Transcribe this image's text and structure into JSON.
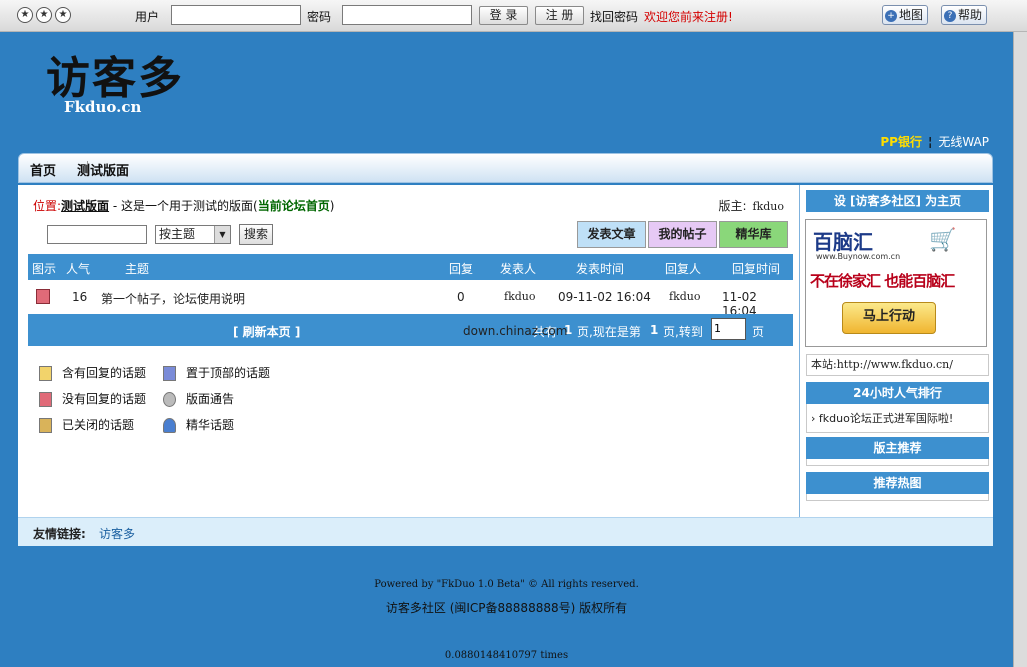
{
  "topbar": {
    "user_label": "用户",
    "pass_label": "密码",
    "login_btn": "登 录",
    "register_btn": "注 册",
    "recover": "找回密码",
    "welcome": "欢迎您前来注册!",
    "map_btn": "地图",
    "help_btn": "帮助"
  },
  "header": {
    "logo": "访客多",
    "logo_sub": "Fkduo.cn",
    "pp_bank": "PP银行",
    "sep": "¦",
    "wap": "无线WAP"
  },
  "nav": {
    "home": "首页",
    "board": "测试版面"
  },
  "location": {
    "label": "位置:",
    "board": "测试版面",
    "desc": " - 这是一个用于测试的版面(",
    "forum_home": "当前论坛首页",
    "close": ")",
    "moderator_label": "版主:",
    "moderator": "fkduo"
  },
  "search": {
    "select_value": "按主题",
    "search_btn": "搜索"
  },
  "actions": {
    "post": "发表文章",
    "my_posts": "我的帖子",
    "elite": "精华库"
  },
  "table": {
    "headers": [
      "图示",
      "人气",
      "主题",
      "回复",
      "发表人",
      "发表时间",
      "回复人",
      "回复时间"
    ],
    "row": {
      "popularity": "16",
      "title": "第一个帖子，论坛使用说明",
      "replies": "0",
      "author": "fkduo",
      "post_time": "09-11-02 16:04",
      "replier": "fkduo",
      "reply_time": "11-02 16:04"
    }
  },
  "pager": {
    "refresh": "[ 刷新本页 ]",
    "total_prefix": "共有",
    "total": "1",
    "current_text": "页,现在是第",
    "current": "1",
    "goto_text": "页,转到",
    "goto_value": "1",
    "suffix": "页"
  },
  "watermark": "down.chinaz.com",
  "legend": {
    "has_reply": "含有回复的话题",
    "top": "置于顶部的话题",
    "no_reply": "没有回复的话题",
    "notice": "版面通告",
    "closed": "已关闭的话题",
    "elite": "精华话题"
  },
  "friends": {
    "label": "友情链接:",
    "link": "访客多"
  },
  "footer": {
    "powered": "Powered by \"FkDuo 1.0 Beta\" © All rights reserved.",
    "copyright": "访客多社区 (闽ICP备88888888号) 版权所有",
    "time": "0.0880148410797 times"
  },
  "sidebar": {
    "set_home": "设 [访客多社区] 为主页",
    "ad": {
      "brand": "百脑汇",
      "site": "www.Buynow.com.cn",
      "slogan": "不在徐家汇 也能百脑汇",
      "cta": "马上行动"
    },
    "site_url": "本站:http://www.fkduo.cn/",
    "hot24_title": "24小时人气排行",
    "hot24_item": "fkduo论坛正式进军国际啦!",
    "mod_recommend": "版主推荐",
    "hot_topics": "推荐热图"
  },
  "colors": {
    "page_bg": "#2e7fc1",
    "table_header": "#3d90cf",
    "welcome_red": "#d40000",
    "pp_yellow": "#ffdd00"
  }
}
